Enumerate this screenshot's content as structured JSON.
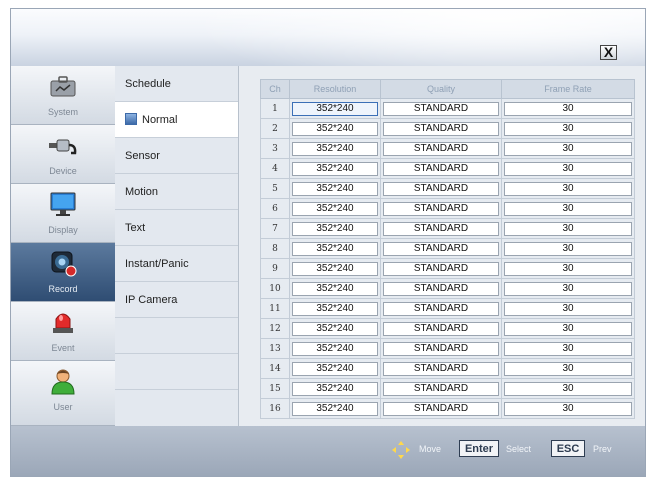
{
  "window": {
    "close_label": "X"
  },
  "sidebar": {
    "items": [
      {
        "label": "System",
        "icon": "toolbox-icon"
      },
      {
        "label": "Device",
        "icon": "cable-plug-icon"
      },
      {
        "label": "Display",
        "icon": "monitor-icon"
      },
      {
        "label": "Record",
        "icon": "camera-record-icon"
      },
      {
        "label": "Event",
        "icon": "alarm-light-icon"
      },
      {
        "label": "User",
        "icon": "user-person-icon"
      }
    ],
    "active": "Record"
  },
  "submenu": {
    "items": [
      "Schedule",
      "Normal",
      "Sensor",
      "Motion",
      "Text",
      "Instant/Panic",
      "IP Camera"
    ],
    "active": "Normal"
  },
  "table": {
    "headers": [
      "Ch",
      "Resolution",
      "Quality",
      "Frame Rate"
    ],
    "rows": [
      {
        "ch": "1",
        "resolution": "352*240",
        "quality": "STANDARD",
        "frame_rate": "30"
      },
      {
        "ch": "2",
        "resolution": "352*240",
        "quality": "STANDARD",
        "frame_rate": "30"
      },
      {
        "ch": "3",
        "resolution": "352*240",
        "quality": "STANDARD",
        "frame_rate": "30"
      },
      {
        "ch": "4",
        "resolution": "352*240",
        "quality": "STANDARD",
        "frame_rate": "30"
      },
      {
        "ch": "5",
        "resolution": "352*240",
        "quality": "STANDARD",
        "frame_rate": "30"
      },
      {
        "ch": "6",
        "resolution": "352*240",
        "quality": "STANDARD",
        "frame_rate": "30"
      },
      {
        "ch": "7",
        "resolution": "352*240",
        "quality": "STANDARD",
        "frame_rate": "30"
      },
      {
        "ch": "8",
        "resolution": "352*240",
        "quality": "STANDARD",
        "frame_rate": "30"
      },
      {
        "ch": "9",
        "resolution": "352*240",
        "quality": "STANDARD",
        "frame_rate": "30"
      },
      {
        "ch": "10",
        "resolution": "352*240",
        "quality": "STANDARD",
        "frame_rate": "30"
      },
      {
        "ch": "11",
        "resolution": "352*240",
        "quality": "STANDARD",
        "frame_rate": "30"
      },
      {
        "ch": "12",
        "resolution": "352*240",
        "quality": "STANDARD",
        "frame_rate": "30"
      },
      {
        "ch": "13",
        "resolution": "352*240",
        "quality": "STANDARD",
        "frame_rate": "30"
      },
      {
        "ch": "14",
        "resolution": "352*240",
        "quality": "STANDARD",
        "frame_rate": "30"
      },
      {
        "ch": "15",
        "resolution": "352*240",
        "quality": "STANDARD",
        "frame_rate": "30"
      },
      {
        "ch": "16",
        "resolution": "352*240",
        "quality": "STANDARD",
        "frame_rate": "30"
      }
    ],
    "selected_row": 1
  },
  "footer": {
    "move_label": "Move",
    "enter_key": "Enter",
    "select_label": "Select",
    "esc_key": "ESC",
    "prev_label": "Prev"
  },
  "colors": {
    "active_side": "#2f4d73",
    "accent_blue": "#3b6fb6",
    "footer_bg": "#9aa6b7"
  }
}
